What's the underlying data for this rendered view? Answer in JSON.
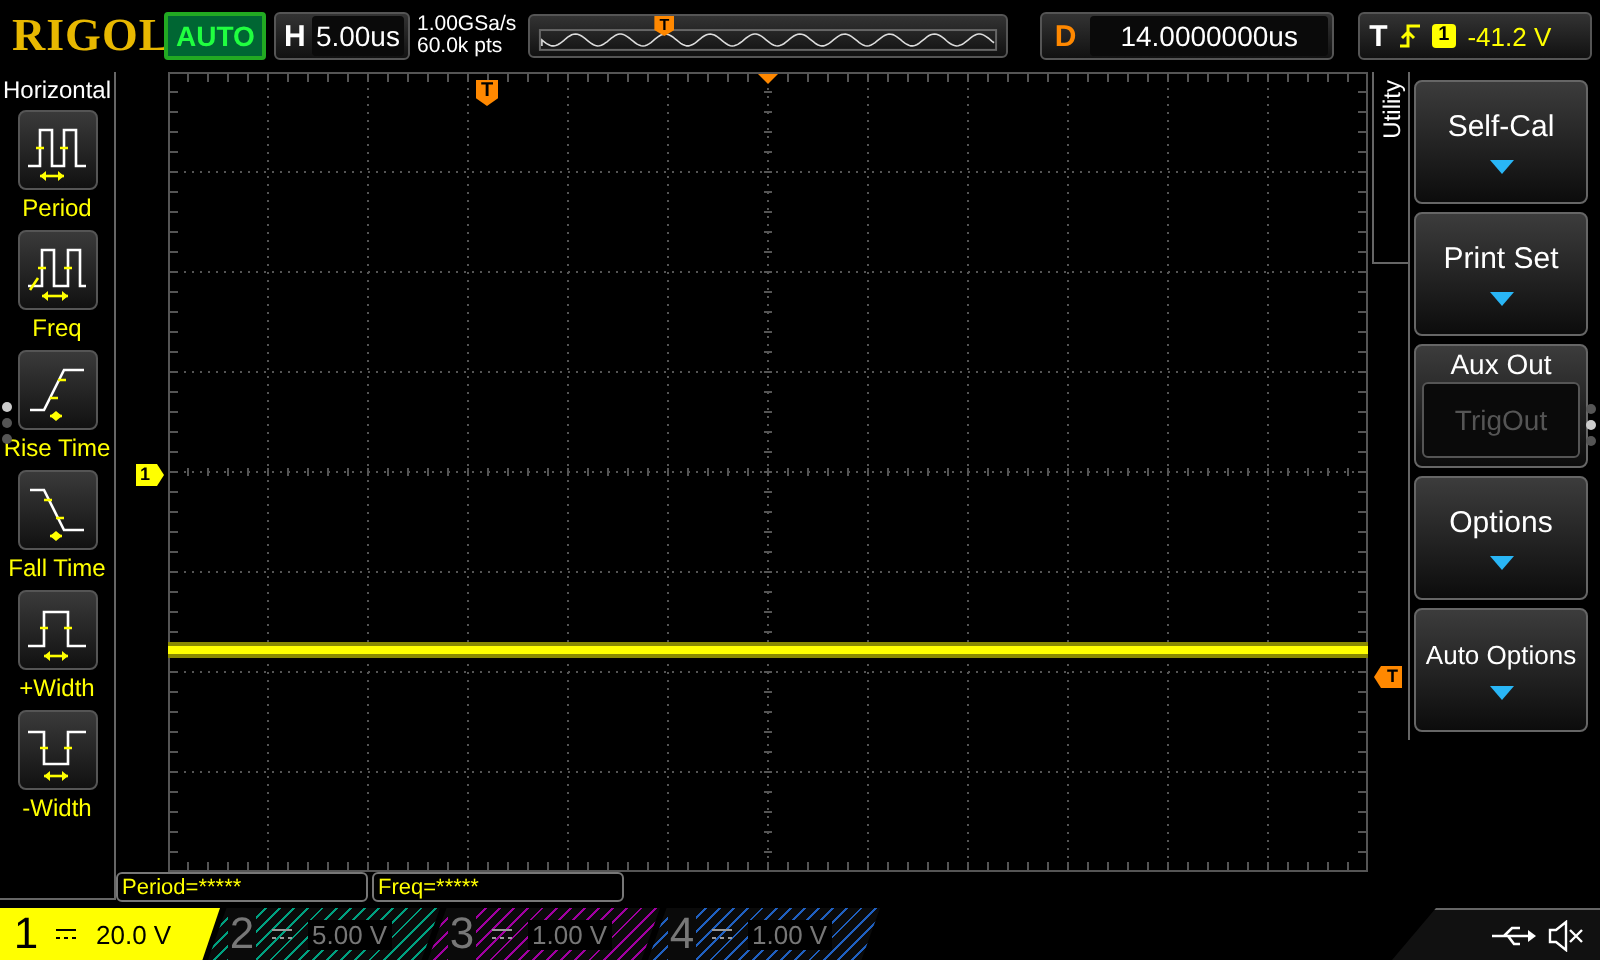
{
  "top_bar": {
    "brand": "RIGOL",
    "run_status": "AUTO",
    "horizontal": {
      "label": "H",
      "timebase": "5.00us",
      "sample_rate": "1.00GSa/s",
      "memory_depth": "60.0k pts",
      "trigger_marker": "T"
    },
    "delay": {
      "label": "D",
      "value": "14.0000000us"
    },
    "trigger": {
      "label": "T",
      "source": "1",
      "level": "-41.2 V"
    }
  },
  "left_menu": {
    "title": "Horizontal",
    "items": [
      {
        "label": "Period",
        "kind": "period"
      },
      {
        "label": "Freq",
        "kind": "freq"
      },
      {
        "label": "Rise Time",
        "kind": "rise"
      },
      {
        "label": "Fall Time",
        "kind": "fall"
      },
      {
        "label": "+Width",
        "kind": "pwidth"
      },
      {
        "label": "-Width",
        "kind": "nwidth"
      }
    ]
  },
  "display": {
    "trigger_position_marker": "T",
    "channel_marker": "1",
    "trigger_level_marker": "T"
  },
  "right_menu": {
    "tab": "Utility",
    "items": [
      {
        "label": "Self-Cal",
        "kind": "submenu"
      },
      {
        "label": "Print Set",
        "kind": "submenu"
      },
      {
        "label": "Aux Out",
        "kind": "choice",
        "value": "TrigOut",
        "disabled": true
      },
      {
        "label": "Options",
        "kind": "submenu"
      },
      {
        "label": "Auto Options",
        "kind": "submenu"
      }
    ]
  },
  "measurements": [
    "Period=*****",
    "Freq=*****"
  ],
  "channels": [
    {
      "number": "1",
      "scale": "20.0 V",
      "on": true,
      "color": "#ffff00"
    },
    {
      "number": "2",
      "scale": "5.00 V",
      "on": false,
      "color": "#00a080"
    },
    {
      "number": "3",
      "scale": "1.00 V",
      "on": false,
      "color": "#a000a0"
    },
    {
      "number": "4",
      "scale": "1.00 V",
      "on": false,
      "color": "#2060c0"
    }
  ]
}
